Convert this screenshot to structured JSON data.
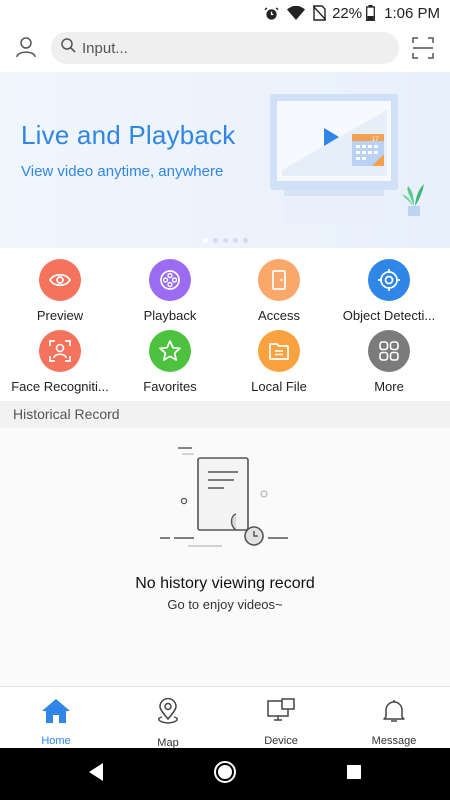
{
  "status_bar": {
    "battery_percent": "22%",
    "time": "1:06 PM",
    "icons": [
      "alarm-icon",
      "wifi-icon",
      "no-sim-icon",
      "battery-icon"
    ]
  },
  "header": {
    "search_placeholder": "Input...",
    "profile_icon": "person-icon",
    "scan_icon": "scan-icon"
  },
  "banner": {
    "title": "Live and Playback",
    "subtitle": "View video anytime, anywhere",
    "calendar_day": "17",
    "slide_count": 5,
    "active_slide": 1
  },
  "functions": [
    {
      "label": "Preview",
      "icon": "eye-icon",
      "color": "#f5735d"
    },
    {
      "label": "Playback",
      "icon": "film-reel-icon",
      "color": "#9b6cf2"
    },
    {
      "label": "Access",
      "icon": "door-icon",
      "color": "#f9a86a"
    },
    {
      "label": "Object Detecti...",
      "icon": "target-icon",
      "color": "#2f86e6"
    },
    {
      "label": "Face Recogniti...",
      "icon": "face-scan-icon",
      "color": "#f5735d"
    },
    {
      "label": "Favorites",
      "icon": "star-icon",
      "color": "#4cc23e"
    },
    {
      "label": "Local File",
      "icon": "folder-icon",
      "color": "#f9a23f"
    },
    {
      "label": "More",
      "icon": "grid-icon",
      "color": "#7b7b7b"
    }
  ],
  "history": {
    "section_title": "Historical Record",
    "empty_title": "No history viewing record",
    "empty_subtitle": "Go to enjoy videos~"
  },
  "bottom_nav": [
    {
      "label": "Home",
      "icon": "home-icon",
      "active": true
    },
    {
      "label": "Map",
      "icon": "map-pin-icon",
      "active": false
    },
    {
      "label": "Device",
      "icon": "device-icon",
      "active": false
    },
    {
      "label": "Message",
      "icon": "bell-icon",
      "active": false
    }
  ],
  "colors": {
    "accent": "#2f86e6",
    "banner_bg": "#eef4fc",
    "section_bg": "#f2f2f2"
  }
}
